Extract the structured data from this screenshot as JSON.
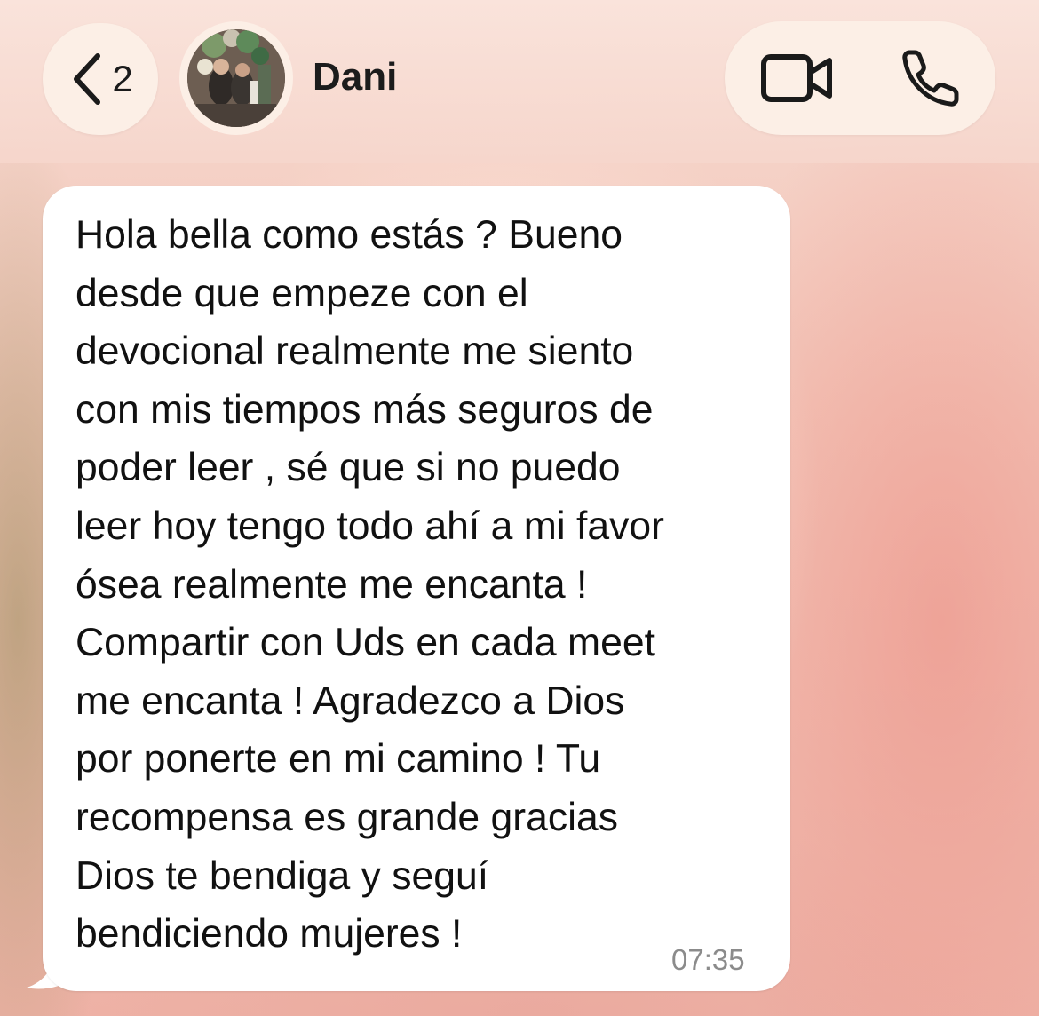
{
  "header": {
    "back_count": "2",
    "contact_name": "Dani",
    "icons": {
      "back": "chevron-left-icon",
      "avatar": "contact-avatar",
      "video": "video-camera-icon",
      "phone": "phone-icon"
    }
  },
  "message": {
    "text": "Hola bella como estás ? Bueno\ndesde que empeze con el\ndevocional realmente me siento\ncon mis tiempos más seguros de\npoder leer , sé que si no puedo\nleer hoy tengo todo ahí a mi favor\nósea realmente me encanta !\nCompartir con Uds en cada meet\nme encanta ! Agradezco a Dios\npor ponerte en mi camino ! Tu\nrecompensa es grande gracias\nDios te bendiga y seguí\nbendiciendo mujeres !",
    "time": "07:35",
    "direction": "incoming"
  },
  "colors": {
    "bubble": "#ffffff",
    "header_pill": "#fcefe6",
    "text": "#111111",
    "timestamp": "#8b8b8b",
    "wallpaper": "#f2c3b6"
  }
}
